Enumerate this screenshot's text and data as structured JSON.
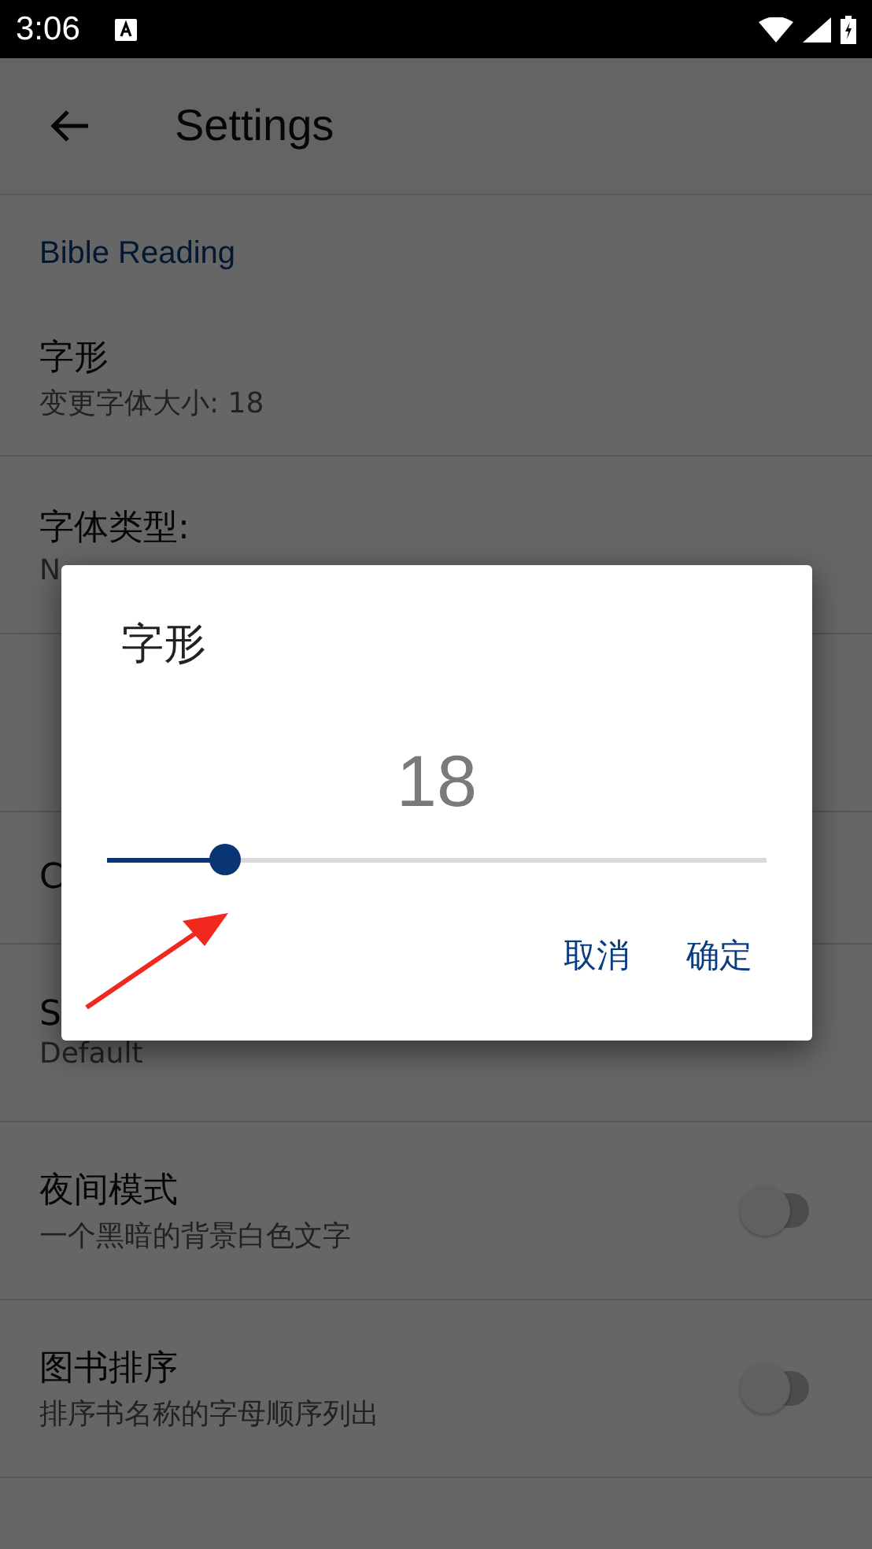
{
  "status_bar": {
    "time": "3:06"
  },
  "app_bar": {
    "title": "Settings"
  },
  "section": {
    "title": "Bible Reading"
  },
  "rows": [
    {
      "kind": "text",
      "title": "字形",
      "subtitle": "变更字体大小: 18"
    },
    {
      "kind": "text",
      "title": "字体类型:",
      "subtitle": "N"
    },
    {
      "kind": "text"
    },
    {
      "kind": "text",
      "title": "C"
    },
    {
      "kind": "text",
      "title": "S",
      "subtitle": "Default"
    },
    {
      "kind": "switch",
      "title": "夜间模式",
      "subtitle": "一个黑暗的背景白色文字",
      "on": false
    },
    {
      "kind": "switch",
      "title": "图书排序",
      "subtitle": "排序书名称的字母顺序列出",
      "on": false
    }
  ],
  "dialog": {
    "title": "字形",
    "value": "18",
    "slider": {
      "level": 0.18
    },
    "buttons": [
      "取消",
      "确定"
    ]
  }
}
